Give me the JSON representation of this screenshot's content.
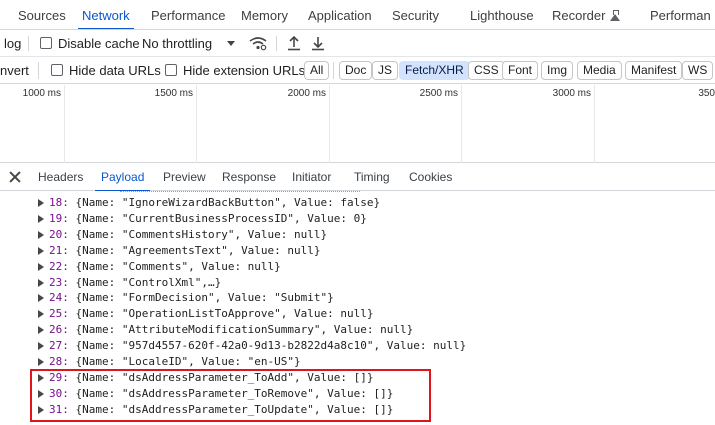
{
  "tabs": [
    {
      "label": "Sources"
    },
    {
      "label": "Network",
      "active": true
    },
    {
      "label": "Performance"
    },
    {
      "label": "Memory"
    },
    {
      "label": "Application"
    },
    {
      "label": "Security"
    },
    {
      "label": "Lighthouse"
    },
    {
      "label": "Recorder"
    },
    {
      "label": "Performan"
    }
  ],
  "toolbar1": {
    "preserve_log_fragment": "log",
    "disable_cache": "Disable cache",
    "throttling": "No throttling"
  },
  "toolbar2": {
    "invert_fragment": "nvert",
    "hide_data_urls": "Hide data URLs",
    "hide_extension_urls": "Hide extension URLs",
    "filters": [
      "All",
      "Doc",
      "JS",
      "Fetch/XHR",
      "CSS",
      "Font",
      "Img",
      "Media",
      "Manifest",
      "WS"
    ],
    "active_filter": "Fetch/XHR"
  },
  "timeline": {
    "ticks": [
      "1000 ms",
      "1500 ms",
      "2000 ms",
      "2500 ms",
      "3000 ms",
      "350"
    ]
  },
  "detail_tabs": [
    "Headers",
    "Payload",
    "Preview",
    "Response",
    "Initiator",
    "Timing",
    "Cookies"
  ],
  "active_detail_tab": "Payload",
  "payload_rows": [
    {
      "index": "18:",
      "text": "{Name: \"IgnoreWizardBackButton\", Value: false}"
    },
    {
      "index": "19:",
      "text": "{Name: \"CurrentBusinessProcessID\", Value: 0}"
    },
    {
      "index": "20:",
      "text": "{Name: \"CommentsHistory\", Value: null}"
    },
    {
      "index": "21:",
      "text": "{Name: \"AgreementsText\", Value: null}"
    },
    {
      "index": "22:",
      "text": "{Name: \"Comments\", Value: null}"
    },
    {
      "index": "23:",
      "text": "{Name: \"ControlXml\",…}"
    },
    {
      "index": "24:",
      "text": "{Name: \"FormDecision\", Value: \"Submit\"}"
    },
    {
      "index": "25:",
      "text": "{Name: \"OperationListToApprove\", Value: null}"
    },
    {
      "index": "26:",
      "text": "{Name: \"AttributeModificationSummary\", Value: null}"
    },
    {
      "index": "27:",
      "text": "{Name: \"957d4557-620f-42a0-9d13-b2822d4a8c10\", Value: null}"
    },
    {
      "index": "28:",
      "text": "{Name: \"LocaleID\", Value: \"en-US\"}"
    },
    {
      "index": "29:",
      "text": "{Name: \"dsAddressParameter_ToAdd\", Value: []}"
    },
    {
      "index": "30:",
      "text": "{Name: \"dsAddressParameter_ToRemove\", Value: []}"
    },
    {
      "index": "31:",
      "text": "{Name: \"dsAddressParameter_ToUpdate\", Value: []}"
    }
  ],
  "colors": {
    "accent": "#0b57d0",
    "highlight_box": "#e0141c",
    "filter_active_bg": "#d3e3fd"
  }
}
